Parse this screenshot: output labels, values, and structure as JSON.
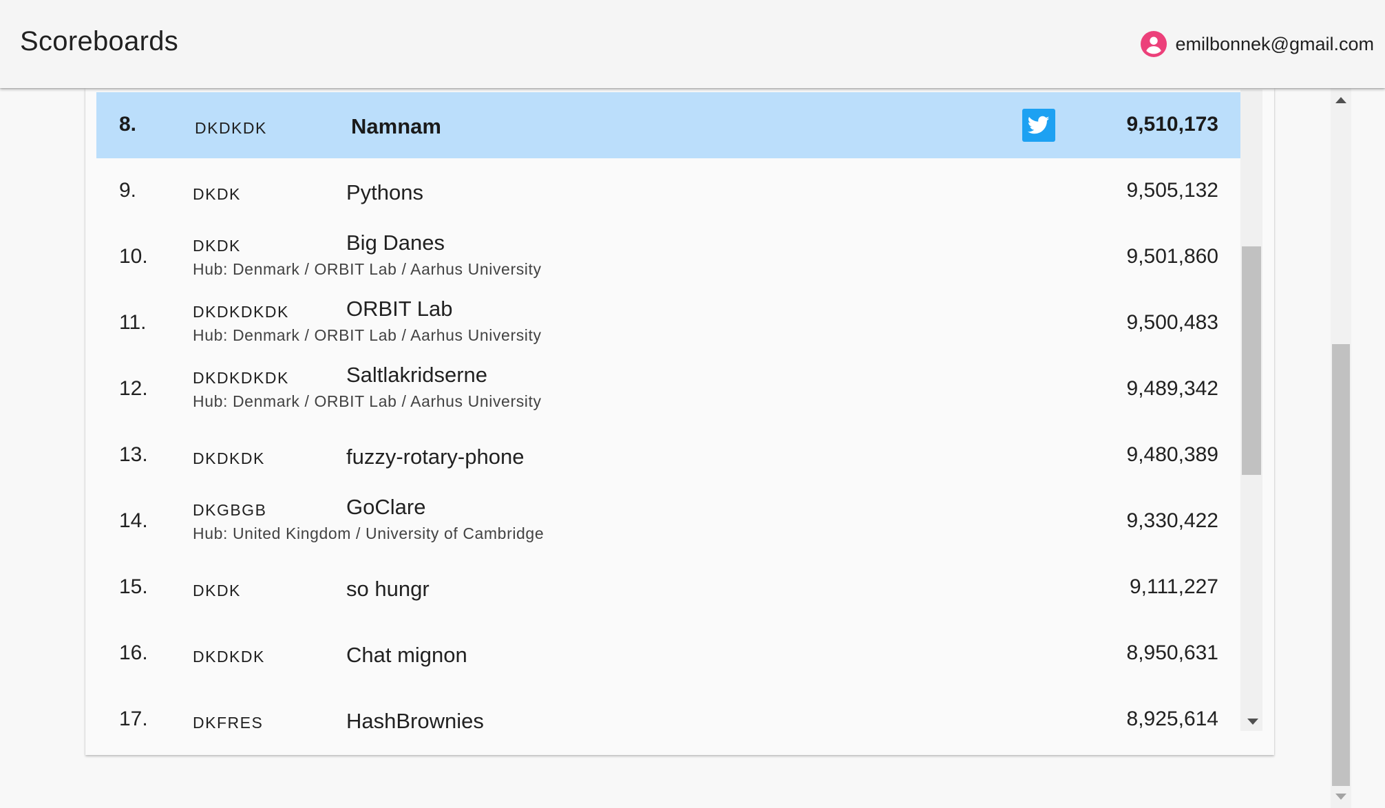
{
  "app": {
    "title": "Scoreboards"
  },
  "account": {
    "email": "emilbonnek@gmail.com",
    "icon": "account-circle-icon",
    "icon_color": "#ec407a"
  },
  "colors": {
    "highlight_row": "#bbdefb",
    "twitter": "#1da1f2"
  },
  "scoreboard": {
    "rows": [
      {
        "rank": "8.",
        "country": "DKDKDK",
        "team": "Namnam",
        "hub": "",
        "score": "9,510,173",
        "highlighted": true,
        "twitter": true
      },
      {
        "rank": "9.",
        "country": "DKDK",
        "team": "Pythons",
        "hub": "",
        "score": "9,505,132",
        "highlighted": false,
        "twitter": false
      },
      {
        "rank": "10.",
        "country": "DKDK",
        "team": "Big Danes",
        "hub": "Hub: Denmark / ORBIT Lab / Aarhus University",
        "score": "9,501,860",
        "highlighted": false,
        "twitter": false
      },
      {
        "rank": "11.",
        "country": "DKDKDKDK",
        "team": "ORBIT Lab",
        "hub": "Hub: Denmark / ORBIT Lab / Aarhus University",
        "score": "9,500,483",
        "highlighted": false,
        "twitter": false
      },
      {
        "rank": "12.",
        "country": "DKDKDKDK",
        "team": "Saltlakridserne",
        "hub": "Hub: Denmark / ORBIT Lab / Aarhus University",
        "score": "9,489,342",
        "highlighted": false,
        "twitter": false
      },
      {
        "rank": "13.",
        "country": "DKDKDK",
        "team": "fuzzy-rotary-phone",
        "hub": "",
        "score": "9,480,389",
        "highlighted": false,
        "twitter": false
      },
      {
        "rank": "14.",
        "country": "DKGBGB",
        "team": "GoClare",
        "hub": "Hub: United Kingdom / University of Cambridge",
        "score": "9,330,422",
        "highlighted": false,
        "twitter": false
      },
      {
        "rank": "15.",
        "country": "DKDK",
        "team": "so hungr",
        "hub": "",
        "score": "9,111,227",
        "highlighted": false,
        "twitter": false
      },
      {
        "rank": "16.",
        "country": "DKDKDK",
        "team": "Chat mignon",
        "hub": "",
        "score": "8,950,631",
        "highlighted": false,
        "twitter": false
      },
      {
        "rank": "17.",
        "country": "DKFRES",
        "team": "HashBrownies",
        "hub": "",
        "score": "8,925,614",
        "highlighted": false,
        "twitter": false
      }
    ]
  }
}
